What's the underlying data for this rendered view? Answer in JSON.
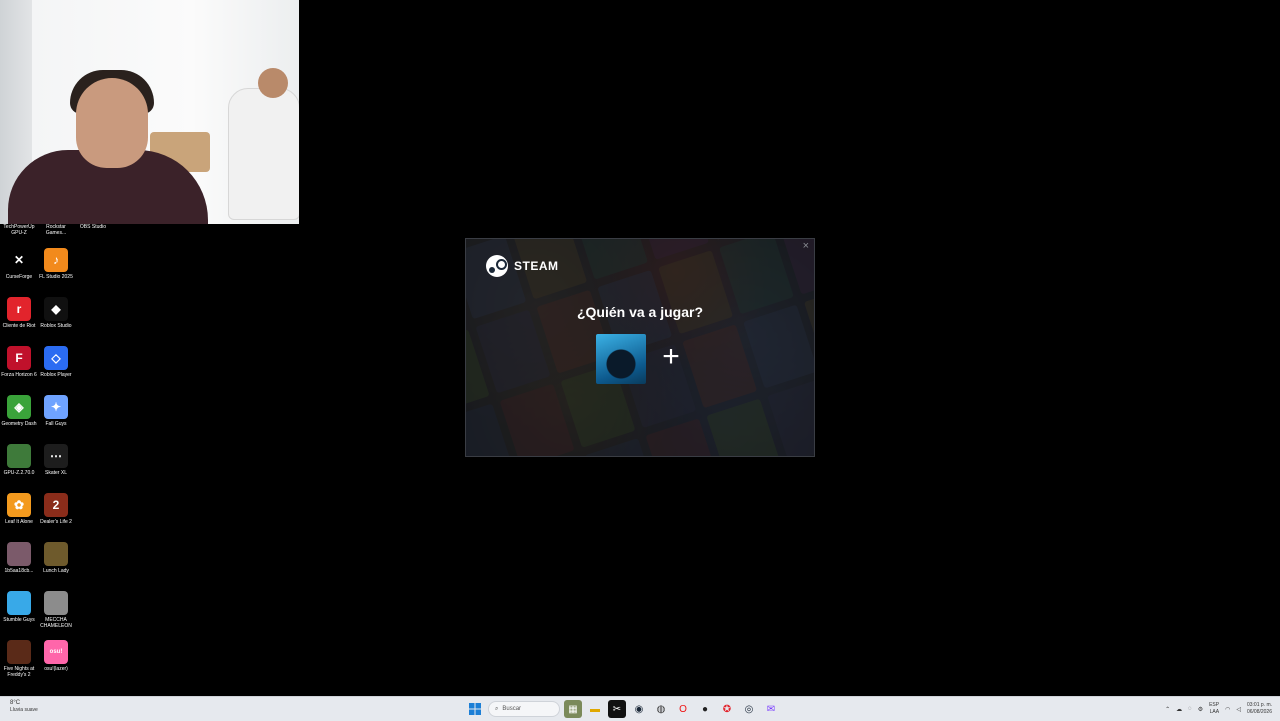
{
  "desktop": {
    "icons": [
      {
        "label": "TechPowerUp GPU-Z",
        "color": "#6a6a6a",
        "glyph": ""
      },
      {
        "label": "Rockstar Games...",
        "color": "#f2a900",
        "glyph": ""
      },
      {
        "label": "OBS Studio",
        "color": "#302e31",
        "glyph": ""
      },
      {
        "label": "CurseForge",
        "color": "#000000",
        "glyph": "✕"
      },
      {
        "label": "FL Studio 2025",
        "color": "#f28a1c",
        "glyph": "♪"
      },
      {
        "label": "Cliente de Riot",
        "color": "#e2242c",
        "glyph": "r"
      },
      {
        "label": "Roblox Studio",
        "color": "#101010",
        "glyph": "◆"
      },
      {
        "label": "Forza Horizon 6",
        "color": "#c0112b",
        "glyph": "F"
      },
      {
        "label": "Roblox Player",
        "color": "#2b6cf2",
        "glyph": "◇"
      },
      {
        "label": "Geometry Dash",
        "color": "#3aa33a",
        "glyph": "◈"
      },
      {
        "label": "Fall Guys",
        "color": "#6fa3ff",
        "glyph": "✦"
      },
      {
        "label": "GPU-Z.2.70.0",
        "color": "#3e7a3a",
        "glyph": ""
      },
      {
        "label": "Skater XL",
        "color": "#1d1d1d",
        "glyph": "⋯"
      },
      {
        "label": "Leaf It Alone",
        "color": "#f39a1e",
        "glyph": "✿"
      },
      {
        "label": "Dealer's Life 2",
        "color": "#8a2c1a",
        "glyph": "2"
      },
      {
        "label": "1b5aa18cb...",
        "color": "#7b5a6a",
        "glyph": ""
      },
      {
        "label": "Lunch Lady",
        "color": "#6e5a2c",
        "glyph": ""
      },
      {
        "label": "Stumble Guys",
        "color": "#38a9e8",
        "glyph": ""
      },
      {
        "label": "MECCHA CHAMELEON",
        "color": "#8c8c8c",
        "glyph": ""
      },
      {
        "label": "Five Nights at Freddy's 2",
        "color": "#5a2a18",
        "glyph": ""
      },
      {
        "label": "osu!(lazer)",
        "color": "#ff66aa",
        "glyph": "osu!"
      }
    ]
  },
  "steam_dialog": {
    "brand": "STEAM",
    "title": "¿Quién va a jugar?",
    "add_glyph": "+",
    "close_glyph": "×"
  },
  "taskbar": {
    "weather_temp": "8°C",
    "weather_desc": "Lluvia suave",
    "search_placeholder": "Buscar",
    "tray_lang": "ESP",
    "tray_lang2": "LAA",
    "clock_time": "03:01 p. m.",
    "clock_date": "06/08/2026"
  }
}
